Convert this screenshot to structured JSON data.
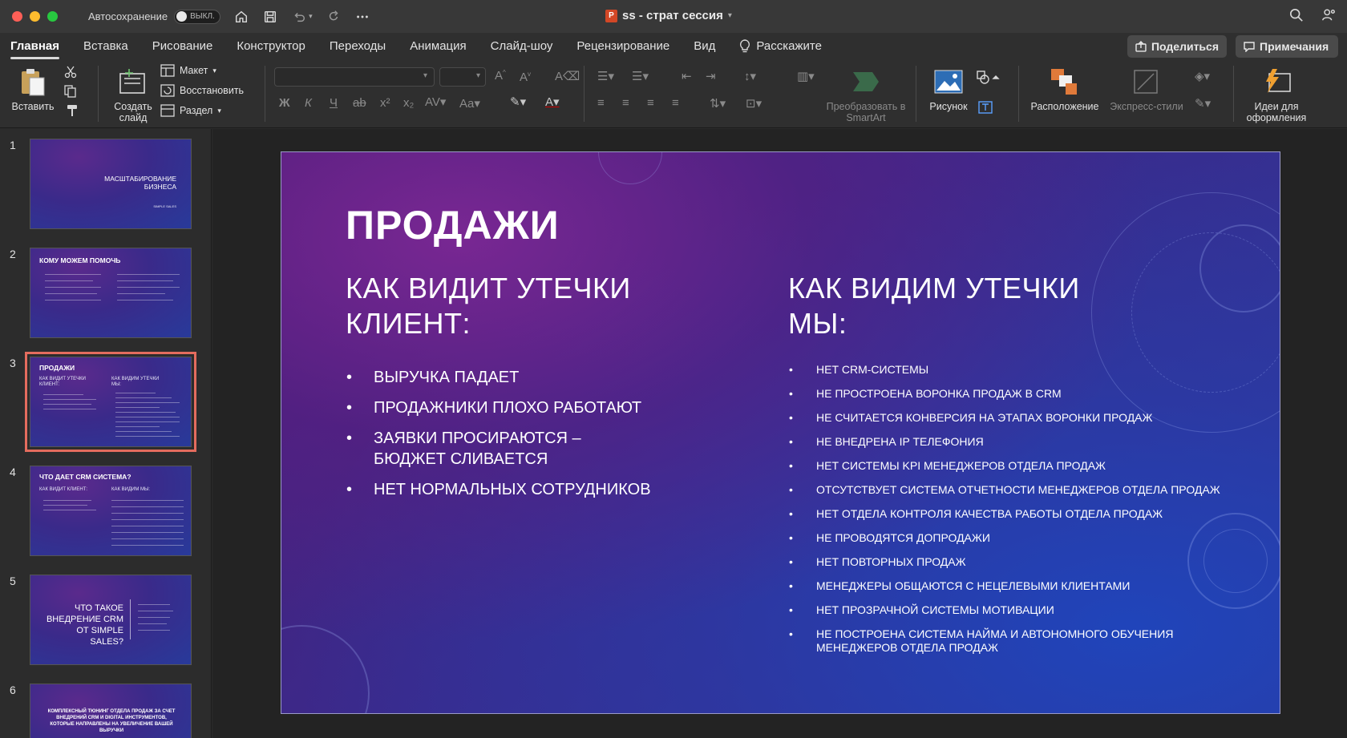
{
  "window": {
    "autosave_label": "Автосохранение",
    "autosave_state": "ВЫКЛ.",
    "doc_title": "ss - страт сессия",
    "doc_badge": "P"
  },
  "menu": {
    "tabs": [
      "Главная",
      "Вставка",
      "Рисование",
      "Конструктор",
      "Переходы",
      "Анимация",
      "Слайд-шоу",
      "Рецензирование",
      "Вид"
    ],
    "tell_me": "Расскажите",
    "share": "Поделиться",
    "comments": "Примечания"
  },
  "ribbon": {
    "paste": "Вставить",
    "new_slide": "Создать слайд",
    "layout": "Макет",
    "reset": "Восстановить",
    "section": "Раздел",
    "smartart": "Преобразовать в SmartArt",
    "picture": "Рисунок",
    "arrange": "Расположение",
    "quick_styles": "Экспресс-стили",
    "design_ideas": "Идеи для оформления",
    "bold": "Ж",
    "italic": "К",
    "underline": "Ч"
  },
  "thumbnails": [
    {
      "num": "1",
      "title": "МАСШТАБИРОВАНИЕ БИЗНЕСА",
      "sub": "SIMPLE SALES"
    },
    {
      "num": "2",
      "title": "КОМУ МОЖЕМ ПОМОЧЬ"
    },
    {
      "num": "3",
      "title": "ПРОДАЖИ",
      "left_head": "КАК ВИДИТ УТЕЧКИ КЛИЕНТ:",
      "right_head": "КАК ВИДИМ УТЕЧКИ МЫ:"
    },
    {
      "num": "4",
      "title": "ЧТО ДАЕТ CRM СИСТЕМА?",
      "left_head": "КАК ВИДИТ КЛИЕНТ:",
      "right_head": "КАК ВИДИМ МЫ:"
    },
    {
      "num": "5",
      "title": "ЧТО ТАКОЕ ВНЕДРЕНИЕ CRM ОТ SIMPLE SALES?"
    },
    {
      "num": "6",
      "title": "КОМПЛЕКСНЫЙ ТЮНИНГ ОТДЕЛА ПРОДАЖ ЗА СЧЕТ ВНЕДРЕНИЙ CRM И DIGITAL ИНСТРУМЕНТОВ, КОТОРЫЕ НАПРАВЛЕНЫ НА УВЕЛИЧЕНИЕ ВАШЕЙ ВЫРУЧКИ"
    }
  ],
  "slide": {
    "title": "ПРОДАЖИ",
    "left_heading": "КАК ВИДИТ УТЕЧКИ КЛИЕНТ:",
    "right_heading": "КАК ВИДИМ УТЕЧКИ МЫ:",
    "left_items": [
      "ВЫРУЧКА ПАДАЕТ",
      "ПРОДАЖНИКИ ПЛОХО РАБОТАЮТ",
      "ЗАЯВКИ ПРОСИРАЮТСЯ – БЮДЖЕТ СЛИВАЕТСЯ",
      "НЕТ НОРМАЛЬНЫХ СОТРУДНИКОВ"
    ],
    "right_items": [
      "НЕТ CRM-СИСТЕМЫ",
      "НЕ ПРОСТРОЕНА ВОРОНКА ПРОДАЖ В CRM",
      "НЕ СЧИТАЕТСЯ КОНВЕРСИЯ НА ЭТАПАХ ВОРОНКИ ПРОДАЖ",
      "НЕ ВНЕДРЕНА IP ТЕЛЕФОНИЯ",
      "НЕТ СИСТЕМЫ KPI МЕНЕДЖЕРОВ ОТДЕЛА ПРОДАЖ",
      "ОТСУТСТВУЕТ СИСТЕМА ОТЧЕТНОСТИ МЕНЕДЖЕРОВ ОТДЕЛА ПРОДАЖ",
      "НЕТ ОТДЕЛА КОНТРОЛЯ КАЧЕСТВА РАБОТЫ ОТДЕЛА ПРОДАЖ",
      "НЕ ПРОВОДЯТСЯ ДОПРОДАЖИ",
      "НЕТ ПОВТОРНЫХ ПРОДАЖ",
      "МЕНЕДЖЕРЫ ОБЩАЮТСЯ С НЕЦЕЛЕВЫМИ КЛИЕНТАМИ",
      "НЕТ ПРОЗРАЧНОЙ СИСТЕМЫ МОТИВАЦИИ",
      "НЕ ПОСТРОЕНА СИСТЕМА НАЙМА И АВТОНОМНОГО ОБУЧЕНИЯ МЕНЕДЖЕРОВ ОТДЕЛА ПРОДАЖ"
    ]
  }
}
